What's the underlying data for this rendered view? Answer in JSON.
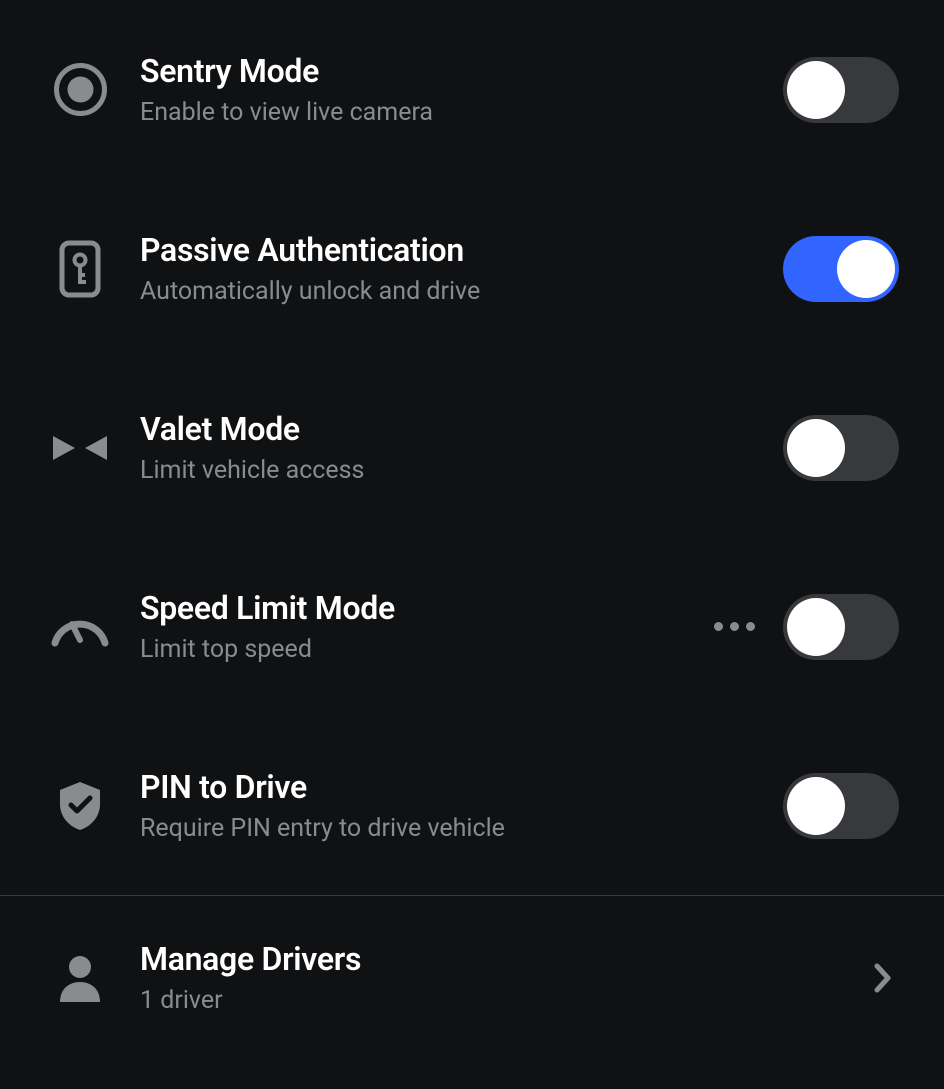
{
  "settings": [
    {
      "id": "sentry",
      "title": "Sentry Mode",
      "subtitle": "Enable to view live camera",
      "enabled": false
    },
    {
      "id": "passive_auth",
      "title": "Passive Authentication",
      "subtitle": "Automatically unlock and drive",
      "enabled": true
    },
    {
      "id": "valet",
      "title": "Valet Mode",
      "subtitle": "Limit vehicle access",
      "enabled": false
    },
    {
      "id": "speed_limit",
      "title": "Speed Limit Mode",
      "subtitle": "Limit top speed",
      "enabled": false,
      "has_more": true
    },
    {
      "id": "pin_to_drive",
      "title": "PIN to Drive",
      "subtitle": "Require PIN entry to drive vehicle",
      "enabled": false
    }
  ],
  "manage_drivers": {
    "title": "Manage Drivers",
    "subtitle": "1 driver"
  }
}
